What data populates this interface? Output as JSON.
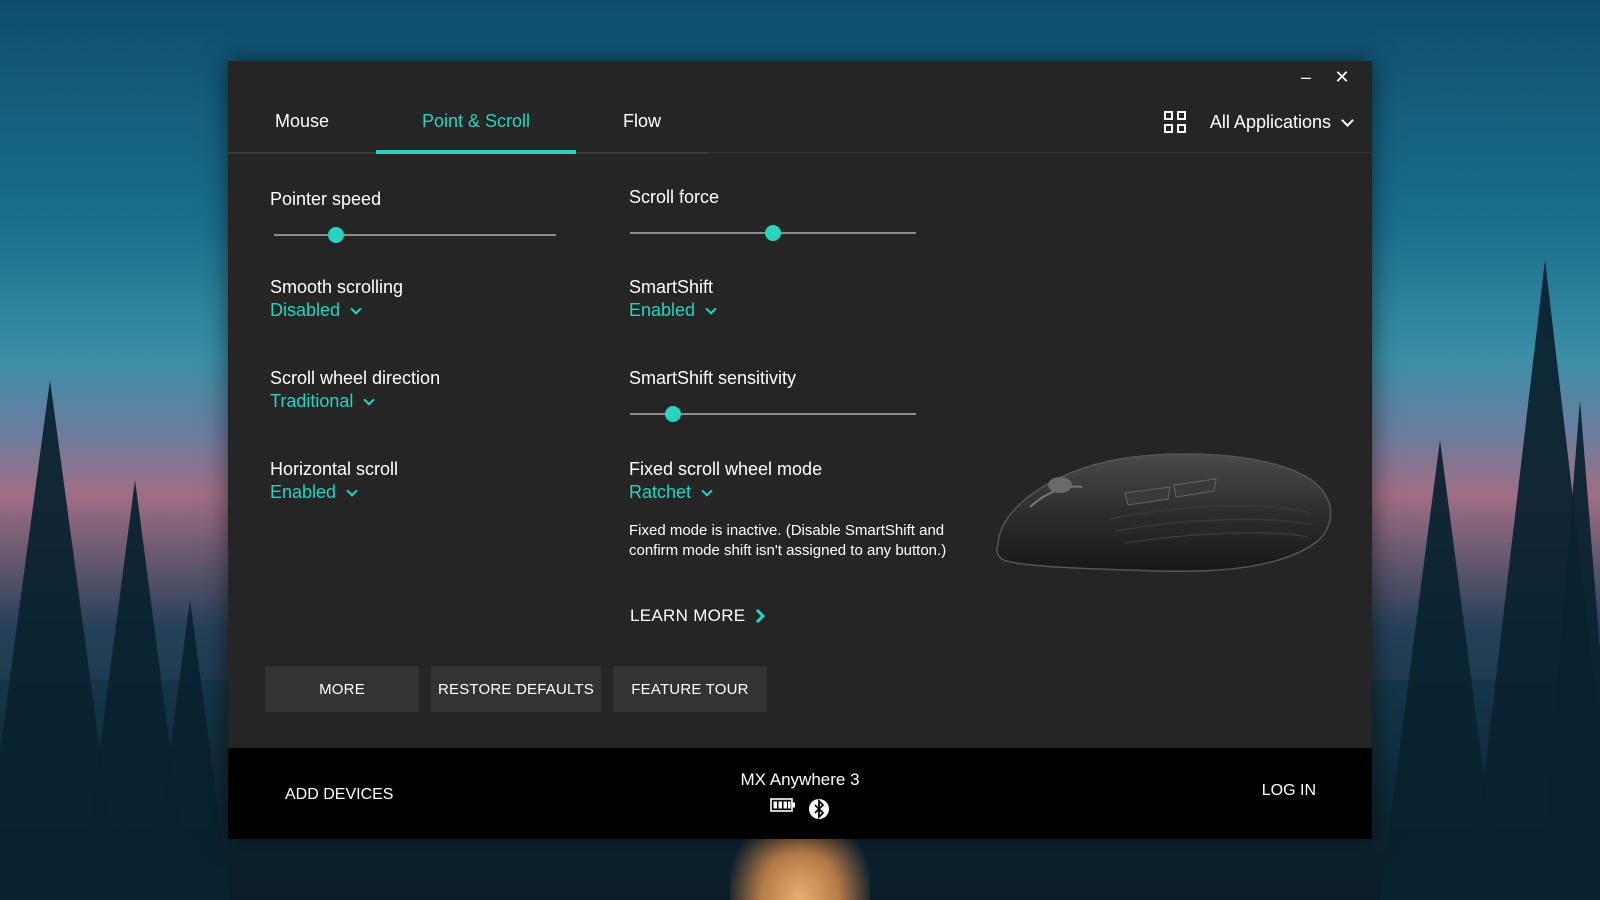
{
  "window": {
    "minimize_glyph": "–",
    "close_glyph": "✕"
  },
  "tabs": [
    {
      "label": "Mouse"
    },
    {
      "label": "Point & Scroll"
    },
    {
      "label": "Flow"
    }
  ],
  "app_selector": {
    "label": "All Applications",
    "icon": "grid-icon"
  },
  "settings": {
    "pointer_speed": {
      "title": "Pointer speed",
      "value_fraction": 0.22
    },
    "scroll_force": {
      "title": "Scroll force",
      "value_fraction": 0.5
    },
    "smooth_scrolling": {
      "title": "Smooth scrolling",
      "value": "Disabled"
    },
    "smartshift": {
      "title": "SmartShift",
      "value": "Enabled"
    },
    "scroll_wheel_direction": {
      "title": "Scroll wheel direction",
      "value": "Traditional"
    },
    "smartshift_sensitivity": {
      "title": "SmartShift sensitivity",
      "value_fraction": 0.15
    },
    "horizontal_scroll": {
      "title": "Horizontal scroll",
      "value": "Enabled"
    },
    "fixed_scroll_wheel_mode": {
      "title": "Fixed scroll wheel mode",
      "value": "Ratchet"
    }
  },
  "note": "Fixed mode is inactive. (Disable SmartShift and confirm mode shift isn't assigned to any button.)",
  "learn_more": "LEARN MORE",
  "buttons": {
    "more": "MORE",
    "restore_defaults": "RESTORE DEFAULTS",
    "feature_tour": "FEATURE TOUR"
  },
  "footer": {
    "add_devices": "ADD DEVICES",
    "device_name": "MX Anywhere 3",
    "login": "LOG IN",
    "icons": [
      "battery-icon",
      "bluetooth-icon"
    ]
  },
  "colors": {
    "accent": "#26d4c0",
    "panel": "#252525",
    "footer": "#000000",
    "button": "#333333"
  }
}
